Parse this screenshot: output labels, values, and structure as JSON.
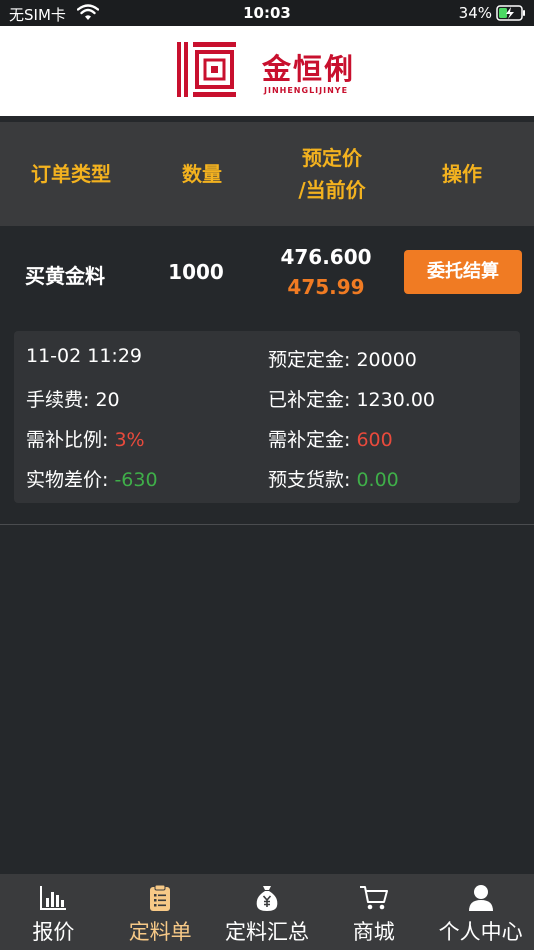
{
  "status_bar": {
    "carrier": "无SIM卡",
    "time": "10:03",
    "battery": "34%"
  },
  "header": {
    "logo_name": "金恒俐",
    "logo_sub": "JINHENGLIJINYE"
  },
  "table": {
    "col_type": "订单类型",
    "col_qty": "数量",
    "col_price_line1": "预定价",
    "col_price_line2": "/当前价",
    "col_op": "操作"
  },
  "order": {
    "type": "买黄金料",
    "qty": "1000",
    "preset_price": "476.600",
    "current_price": "475.99",
    "action_label": "委托结算",
    "details": {
      "datetime": "11-02 11:29",
      "deposit_label": "预定定金: ",
      "deposit_value": "20000",
      "fee_label": "手续费: ",
      "fee_value": "20",
      "paid_label": "已补定金: ",
      "paid_value": "1230.00",
      "ratio_label": "需补比例: ",
      "ratio_value": "3%",
      "need_label": "需补定金: ",
      "need_value": "600",
      "diff_label": "实物差价: ",
      "diff_value": "-630",
      "prepay_label": "预支货款: ",
      "prepay_value": "0.00"
    }
  },
  "tabs": [
    {
      "label": "报价",
      "icon": "bar-chart-icon"
    },
    {
      "label": "定料单",
      "icon": "clipboard-icon",
      "active": true
    },
    {
      "label": "定料汇总",
      "icon": "money-bag-icon"
    },
    {
      "label": "商城",
      "icon": "cart-icon"
    },
    {
      "label": "个人中心",
      "icon": "user-icon"
    }
  ],
  "colors": {
    "accent_yellow": "#f3b21f",
    "accent_orange": "#f07b23",
    "brand_red": "#c8102e",
    "negative_red": "#e84a3c",
    "positive_green": "#3fae49",
    "tab_active": "#f7c987"
  }
}
